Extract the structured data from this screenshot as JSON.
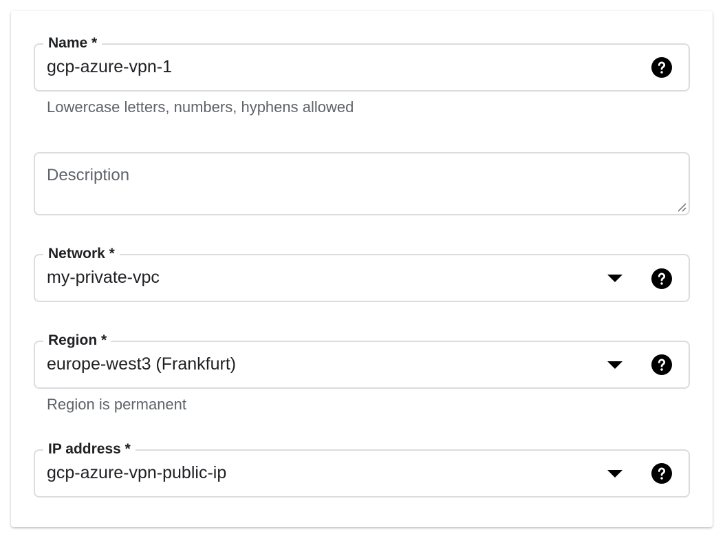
{
  "form": {
    "name": {
      "label": "Name *",
      "value": "gcp-azure-vpn-1",
      "hint": "Lowercase letters, numbers, hyphens allowed",
      "help_icon": "help-circle-icon"
    },
    "description": {
      "placeholder": "Description"
    },
    "network": {
      "label": "Network *",
      "value": "my-private-vpc",
      "dropdown_icon": "caret-down-icon",
      "help_icon": "help-circle-icon"
    },
    "region": {
      "label": "Region *",
      "value": "europe-west3 (Frankfurt)",
      "hint": "Region is permanent",
      "dropdown_icon": "caret-down-icon",
      "help_icon": "help-circle-icon"
    },
    "ip_address": {
      "label": "IP address *",
      "value": "gcp-azure-vpn-public-ip",
      "dropdown_icon": "caret-down-icon",
      "help_icon": "help-circle-icon"
    }
  },
  "colors": {
    "border": "#dadce0",
    "text": "#202124",
    "secondary_text": "#5f6368",
    "icon": "#000000"
  }
}
